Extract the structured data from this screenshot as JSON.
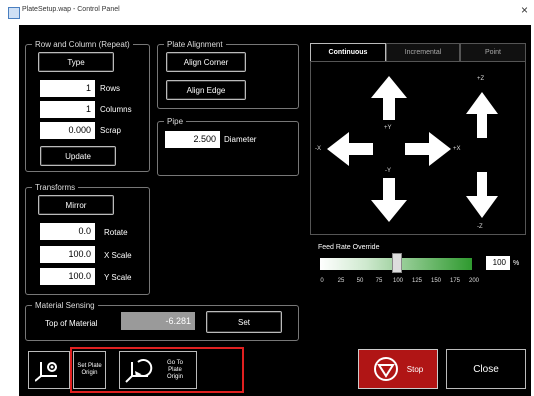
{
  "window": {
    "title": "PlateSetup.wap - Control Panel",
    "close_glyph": "×"
  },
  "row_col": {
    "title": "Row and Column (Repeat)",
    "type_label": "Type",
    "rows_value": "1",
    "rows_label": "Rows",
    "columns_value": "1",
    "columns_label": "Columns",
    "scrap_value": "0.000",
    "scrap_label": "Scrap",
    "update_label": "Update"
  },
  "plate_alignment": {
    "title": "Plate Alignment",
    "align_corner_label": "Align Corner",
    "align_edge_label": "Align Edge"
  },
  "pipe": {
    "title": "Pipe",
    "diameter_value": "2.500",
    "diameter_label": "Diameter"
  },
  "transforms": {
    "title": "Transforms",
    "mirror_label": "Mirror",
    "rotate_value": "0.0",
    "rotate_label": "Rotate",
    "xscale_value": "100.0",
    "xscale_label": "X Scale",
    "yscale_value": "100.0",
    "yscale_label": "Y Scale"
  },
  "material_sensing": {
    "title": "Material Sensing",
    "top_label": "Top of Material",
    "top_value": "-6.281",
    "set_label": "Set"
  },
  "jog": {
    "tabs": [
      {
        "label": "Continuous",
        "active": true
      },
      {
        "label": "Incremental",
        "active": false
      },
      {
        "label": "Point",
        "active": false
      }
    ],
    "axis_labels": {
      "plus_y": "+Y",
      "minus_y": "-Y",
      "plus_x": "+X",
      "minus_x": "-X",
      "plus_z": "+Z",
      "minus_z": "-Z"
    }
  },
  "feed_rate": {
    "title": "Feed Rate Override",
    "value": "100",
    "unit": "%",
    "level_percent": 100,
    "ticks": [
      "0",
      "25",
      "50",
      "75",
      "100",
      "125",
      "150",
      "175",
      "200"
    ]
  },
  "bottom": {
    "set_origin_label": "Set Plate Origin",
    "goto_origin_label": "Go To Plate Origin",
    "stop_label": "Stop",
    "close_label": "Close"
  },
  "colors": {
    "accent_red": "#e02020",
    "stop_red": "#b01515",
    "slider_green": "#2f9a2f"
  }
}
